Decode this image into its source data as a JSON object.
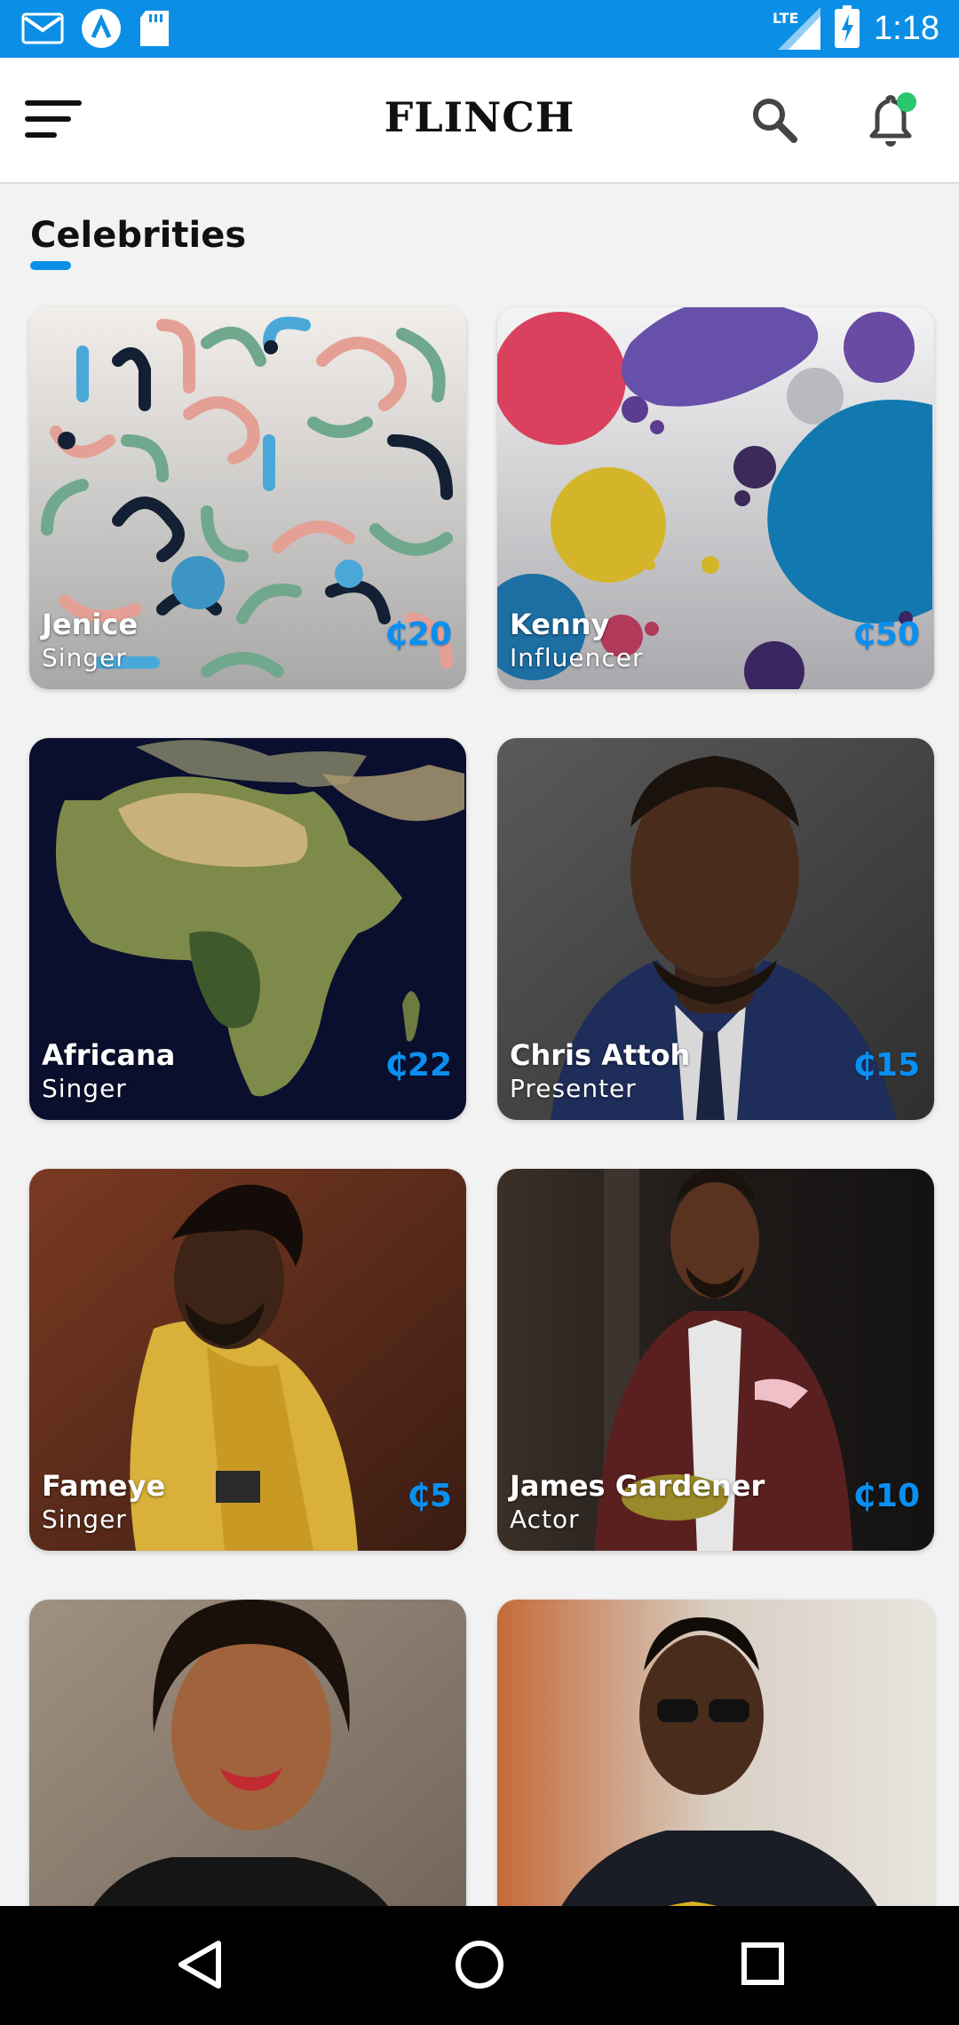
{
  "status_bar": {
    "time": "1:18",
    "network": "LTE",
    "icons": [
      "gmail-icon",
      "app-icon",
      "sd-card-icon",
      "signal-icon",
      "battery-charging-icon"
    ]
  },
  "app_bar": {
    "title": "FLINCH",
    "menu_icon": "hamburger-menu-icon",
    "search_icon": "search-icon",
    "notification_icon": "bell-icon",
    "notification_dot_color": "#28c76f"
  },
  "section": {
    "title": "Celebrities",
    "accent_color": "#0b8fe6"
  },
  "cards": [
    {
      "name": "Jenice",
      "role": "Singer",
      "price": "₵20"
    },
    {
      "name": "Kenny",
      "role": "Influencer",
      "price": "₵50"
    },
    {
      "name": "Africana",
      "role": "Singer",
      "price": "₵22"
    },
    {
      "name": "Chris Attoh",
      "role": "Presenter",
      "price": "₵15"
    },
    {
      "name": "Fameye",
      "role": "Singer",
      "price": "₵5"
    },
    {
      "name": "James Gardener",
      "role": "Actor",
      "price": "₵10"
    },
    {
      "name": "",
      "role": "",
      "price": ""
    },
    {
      "name": "",
      "role": "",
      "price": ""
    }
  ],
  "nav_bar": {
    "buttons": [
      "back-icon",
      "home-icon",
      "recents-icon"
    ]
  }
}
